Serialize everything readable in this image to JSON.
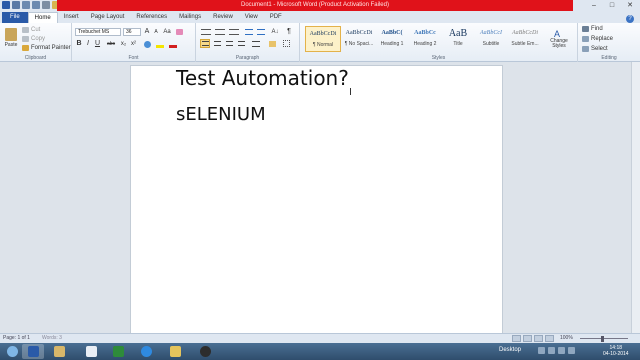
{
  "window": {
    "title": "Document1 - Microsoft Word (Product Activation Failed)",
    "qat_icons": [
      "word-icon",
      "save-icon",
      "undo-icon",
      "redo-icon",
      "print-icon",
      "open-icon"
    ],
    "controls": [
      "–",
      "□",
      "✕"
    ]
  },
  "tabs": [
    {
      "label": "File"
    },
    {
      "label": "Home"
    },
    {
      "label": "Insert"
    },
    {
      "label": "Page Layout"
    },
    {
      "label": "References"
    },
    {
      "label": "Mailings"
    },
    {
      "label": "Review"
    },
    {
      "label": "View"
    },
    {
      "label": "PDF"
    }
  ],
  "active_tab": "Home",
  "ribbon": {
    "clipboard": {
      "paste": "Paste",
      "cut": "Cut",
      "copy": "Copy",
      "format_painter": "Format Painter",
      "label": "Clipboard"
    },
    "font": {
      "family": "Trebuchet MS",
      "size": "36",
      "label": "Font",
      "bold": "B",
      "italic": "I",
      "underline": "U",
      "strike": "abc",
      "sub": "x₂",
      "sup": "x²",
      "grow": "A",
      "shrink": "A",
      "case": "Aa"
    },
    "paragraph": {
      "label": "Paragraph",
      "pilcrow": "¶"
    },
    "styles": {
      "label": "Styles",
      "items": [
        {
          "preview": "AaBbCcDi",
          "name": "¶ Normal"
        },
        {
          "preview": "AaBbCcDi",
          "name": "¶ No Spaci..."
        },
        {
          "preview": "AaBbC(",
          "name": "Heading 1"
        },
        {
          "preview": "AaBbCc",
          "name": "Heading 2"
        },
        {
          "preview": "AaB",
          "name": "Title"
        },
        {
          "preview": "AaBbCcI",
          "name": "Subtitle"
        },
        {
          "preview": "AaBbCcDi",
          "name": "Subtle Em..."
        }
      ],
      "change_styles": "Change Styles"
    },
    "editing": {
      "label": "Editing",
      "find": "Find",
      "replace": "Replace",
      "select": "Select"
    }
  },
  "document": {
    "line1": "Test Automation?",
    "line2": "sELENIUM"
  },
  "status": {
    "page": "Page: 1 of 1",
    "words": "Words: 3",
    "zoom": "100%"
  },
  "taskbar": {
    "apps": [
      "word-icon",
      "image-icon",
      "explorer-icon",
      "excel-icon",
      "ie-icon",
      "folder-icon",
      "media-icon"
    ],
    "desktop": "Desktop",
    "time": "14:18",
    "date": "04-10-2014"
  }
}
